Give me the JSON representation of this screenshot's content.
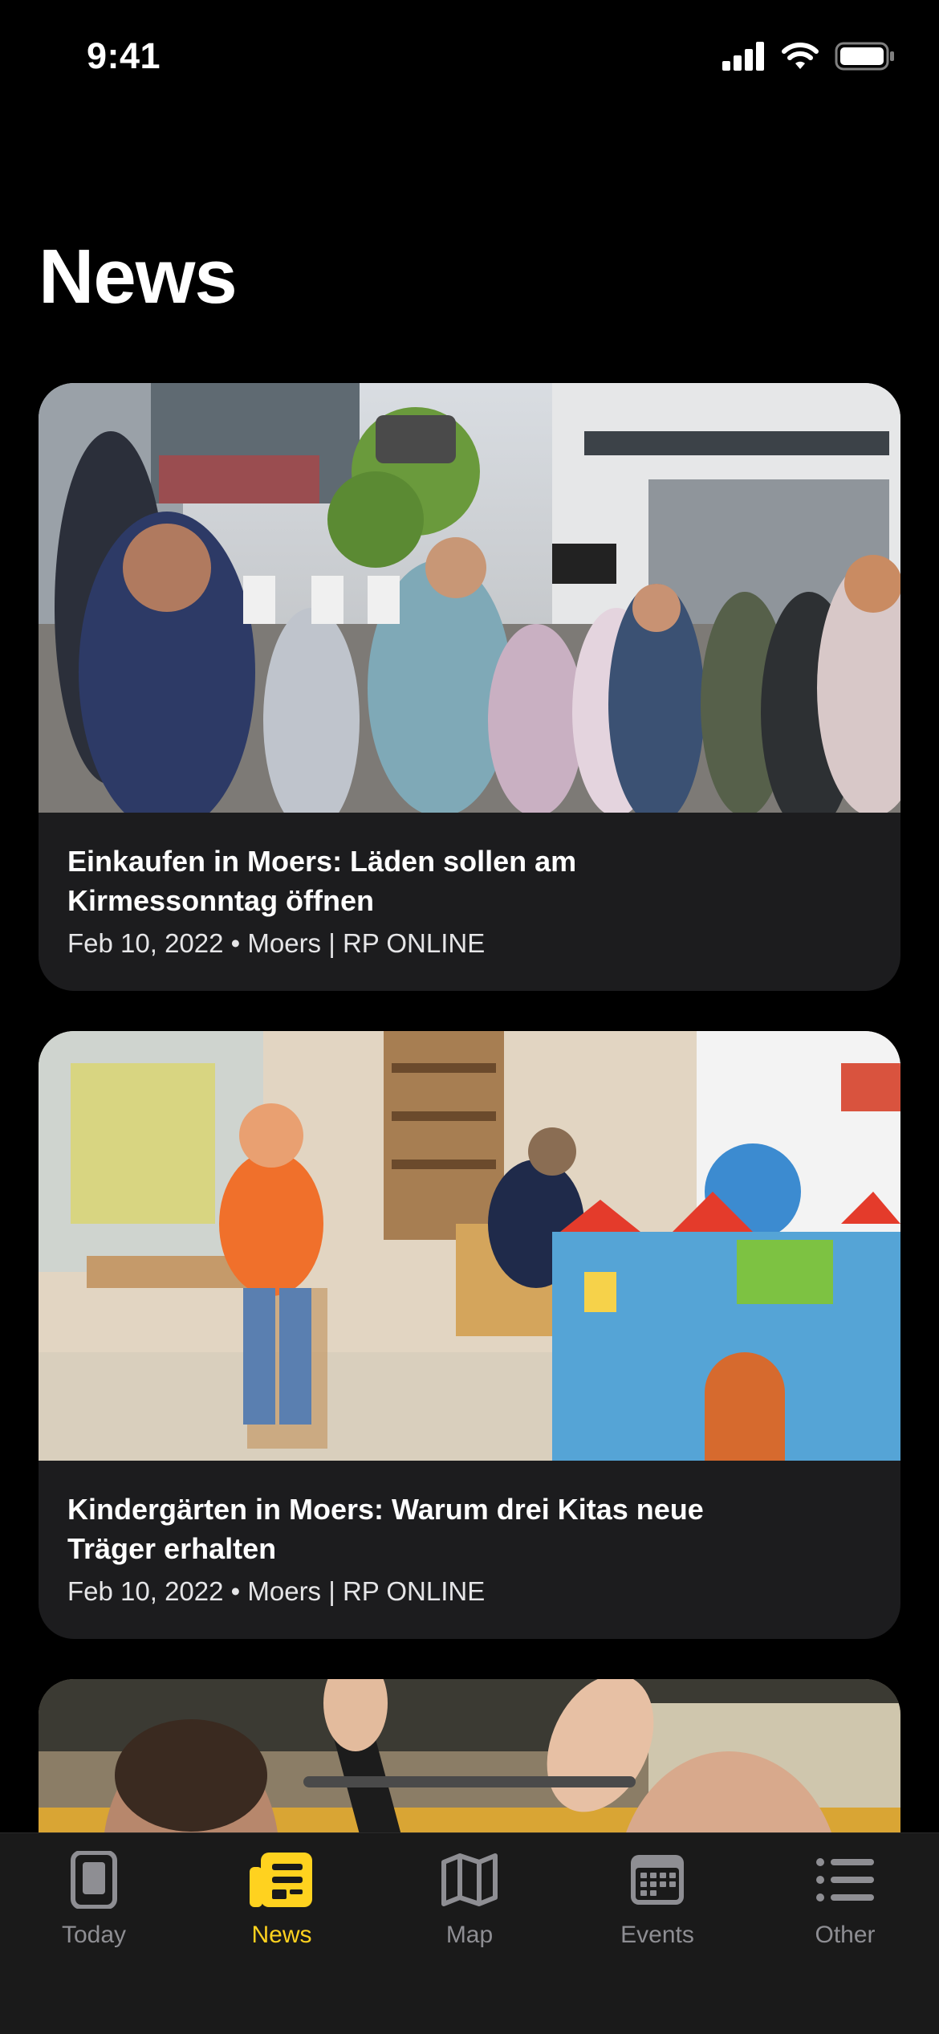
{
  "status": {
    "time": "9:41"
  },
  "page": {
    "title": "News"
  },
  "articles": [
    {
      "title": "Einkaufen in Moers: Läden sollen am Kirmessonntag öffnen",
      "meta": "Feb 10, 2022 • Moers | RP ONLINE",
      "image": "street-crowd-photo"
    },
    {
      "title": "Kindergärten in Moers: Warum drei Kitas neue Träger erhalten",
      "meta": "Feb 10, 2022 • Moers | RP ONLINE",
      "image": "kindergarten-castle-puzzle-photo"
    },
    {
      "image": "sports-high-five-photo"
    }
  ],
  "tabs": [
    {
      "label": "Today",
      "icon": "tablet-icon",
      "active": false
    },
    {
      "label": "News",
      "icon": "newspaper-icon",
      "active": true
    },
    {
      "label": "Map",
      "icon": "map-icon",
      "active": false
    },
    {
      "label": "Events",
      "icon": "calendar-icon",
      "active": false
    },
    {
      "label": "Other",
      "icon": "list-icon",
      "active": false
    }
  ],
  "colors": {
    "accent": "#ffd21f",
    "inactive": "#8e8e93",
    "card_bg": "#1c1c1e",
    "tab_bg": "#1a1a1a"
  }
}
